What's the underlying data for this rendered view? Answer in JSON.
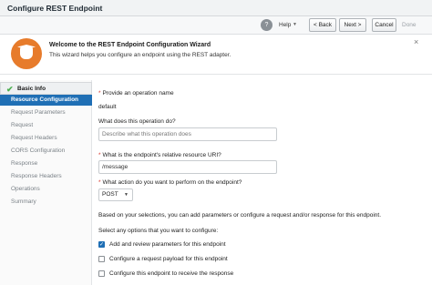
{
  "window": {
    "title": "Configure REST Endpoint"
  },
  "toolbar": {
    "help_label": "Help",
    "help_icon": "help-circle-icon",
    "back_label": "< Back",
    "next_label": "Next >",
    "cancel_label": "Cancel",
    "done_label": "Done"
  },
  "banner": {
    "title": "Welcome to the REST Endpoint Configuration Wizard",
    "description": "This wizard helps you configure an endpoint using the REST adapter.",
    "icon": "wizard-hat-icon",
    "close_glyph": "×",
    "accent": "#e77b2b"
  },
  "sidebar": {
    "items": [
      {
        "label": "Basic Info",
        "state": "completed"
      },
      {
        "label": "Resource Configuration",
        "state": "active"
      },
      {
        "label": "Request Parameters",
        "state": "disabled"
      },
      {
        "label": "Request",
        "state": "disabled"
      },
      {
        "label": "Request Headers",
        "state": "disabled"
      },
      {
        "label": "CORS Configuration",
        "state": "disabled"
      },
      {
        "label": "Response",
        "state": "disabled"
      },
      {
        "label": "Response Headers",
        "state": "disabled"
      },
      {
        "label": "Operations",
        "state": "disabled"
      },
      {
        "label": "Summary",
        "state": "disabled"
      }
    ],
    "active_color": "#1f6fb5"
  },
  "form": {
    "required_marker": "*",
    "operation_name_label": "Provide an operation name",
    "operation_name_value": "default",
    "operation_desc_label": "What does this operation do?",
    "operation_desc_placeholder": "Describe what this operation does",
    "resource_uri_label": "What is the endpoint's relative resource URI?",
    "resource_uri_value": "/message",
    "action_label": "What action do you want to perform on the endpoint?",
    "action_value": "POST",
    "based_on_text": "Based on your selections, you can add parameters or configure a request and/or response for this endpoint.",
    "select_options_text": "Select any options that you want to configure:",
    "options": [
      {
        "label": "Add and review parameters for this endpoint",
        "checked": true
      },
      {
        "label": "Configure a request payload for this endpoint",
        "checked": false
      },
      {
        "label": "Configure this endpoint to receive the response",
        "checked": false
      }
    ]
  }
}
